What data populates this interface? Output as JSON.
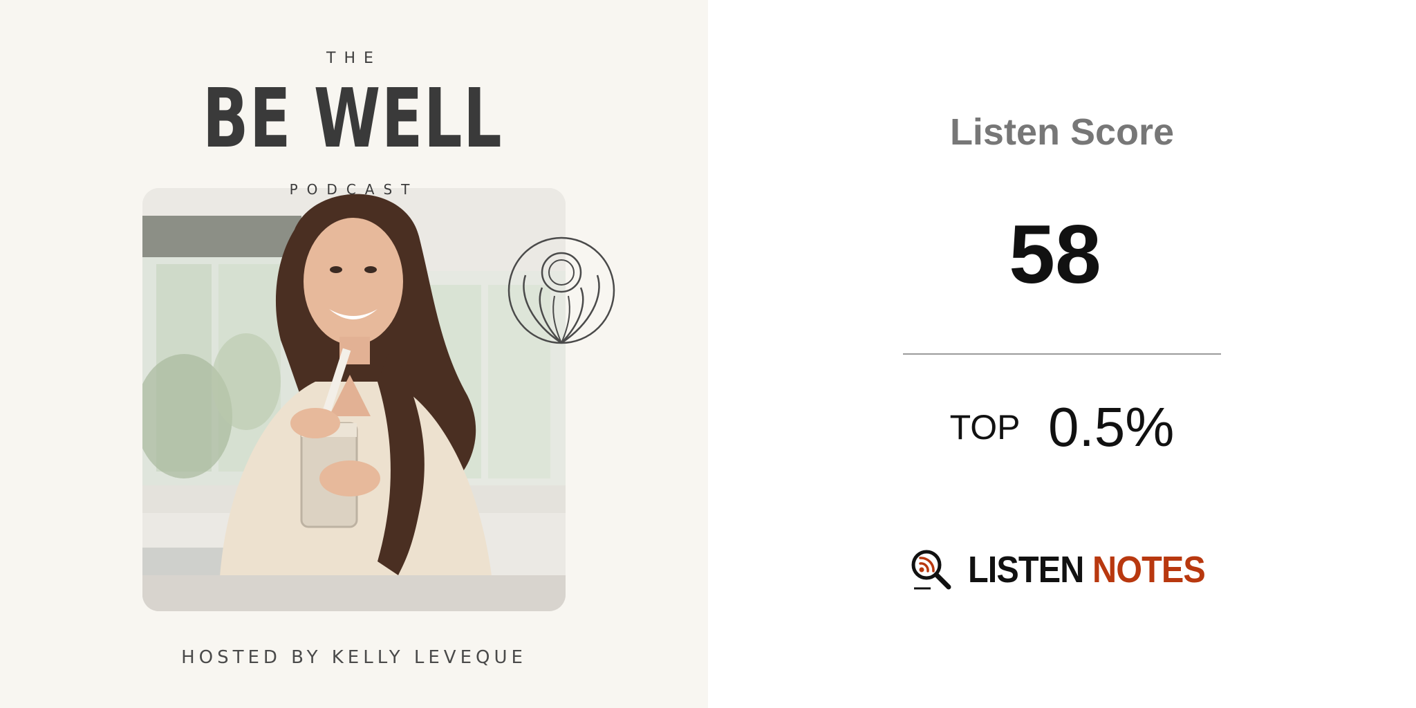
{
  "cover": {
    "the": "THE",
    "title": "BE WELL",
    "podcast": "PODCAST",
    "hosted_by": "HOSTED BY KELLY LEVEQUE"
  },
  "score": {
    "title": "Listen Score",
    "value": "58",
    "top_label": "TOP",
    "top_value": "0.5%"
  },
  "brand": {
    "listen": "LISTEN",
    "notes": "NOTES",
    "icon": "magnifier-podcast-icon",
    "accent_color": "#b8380f"
  }
}
